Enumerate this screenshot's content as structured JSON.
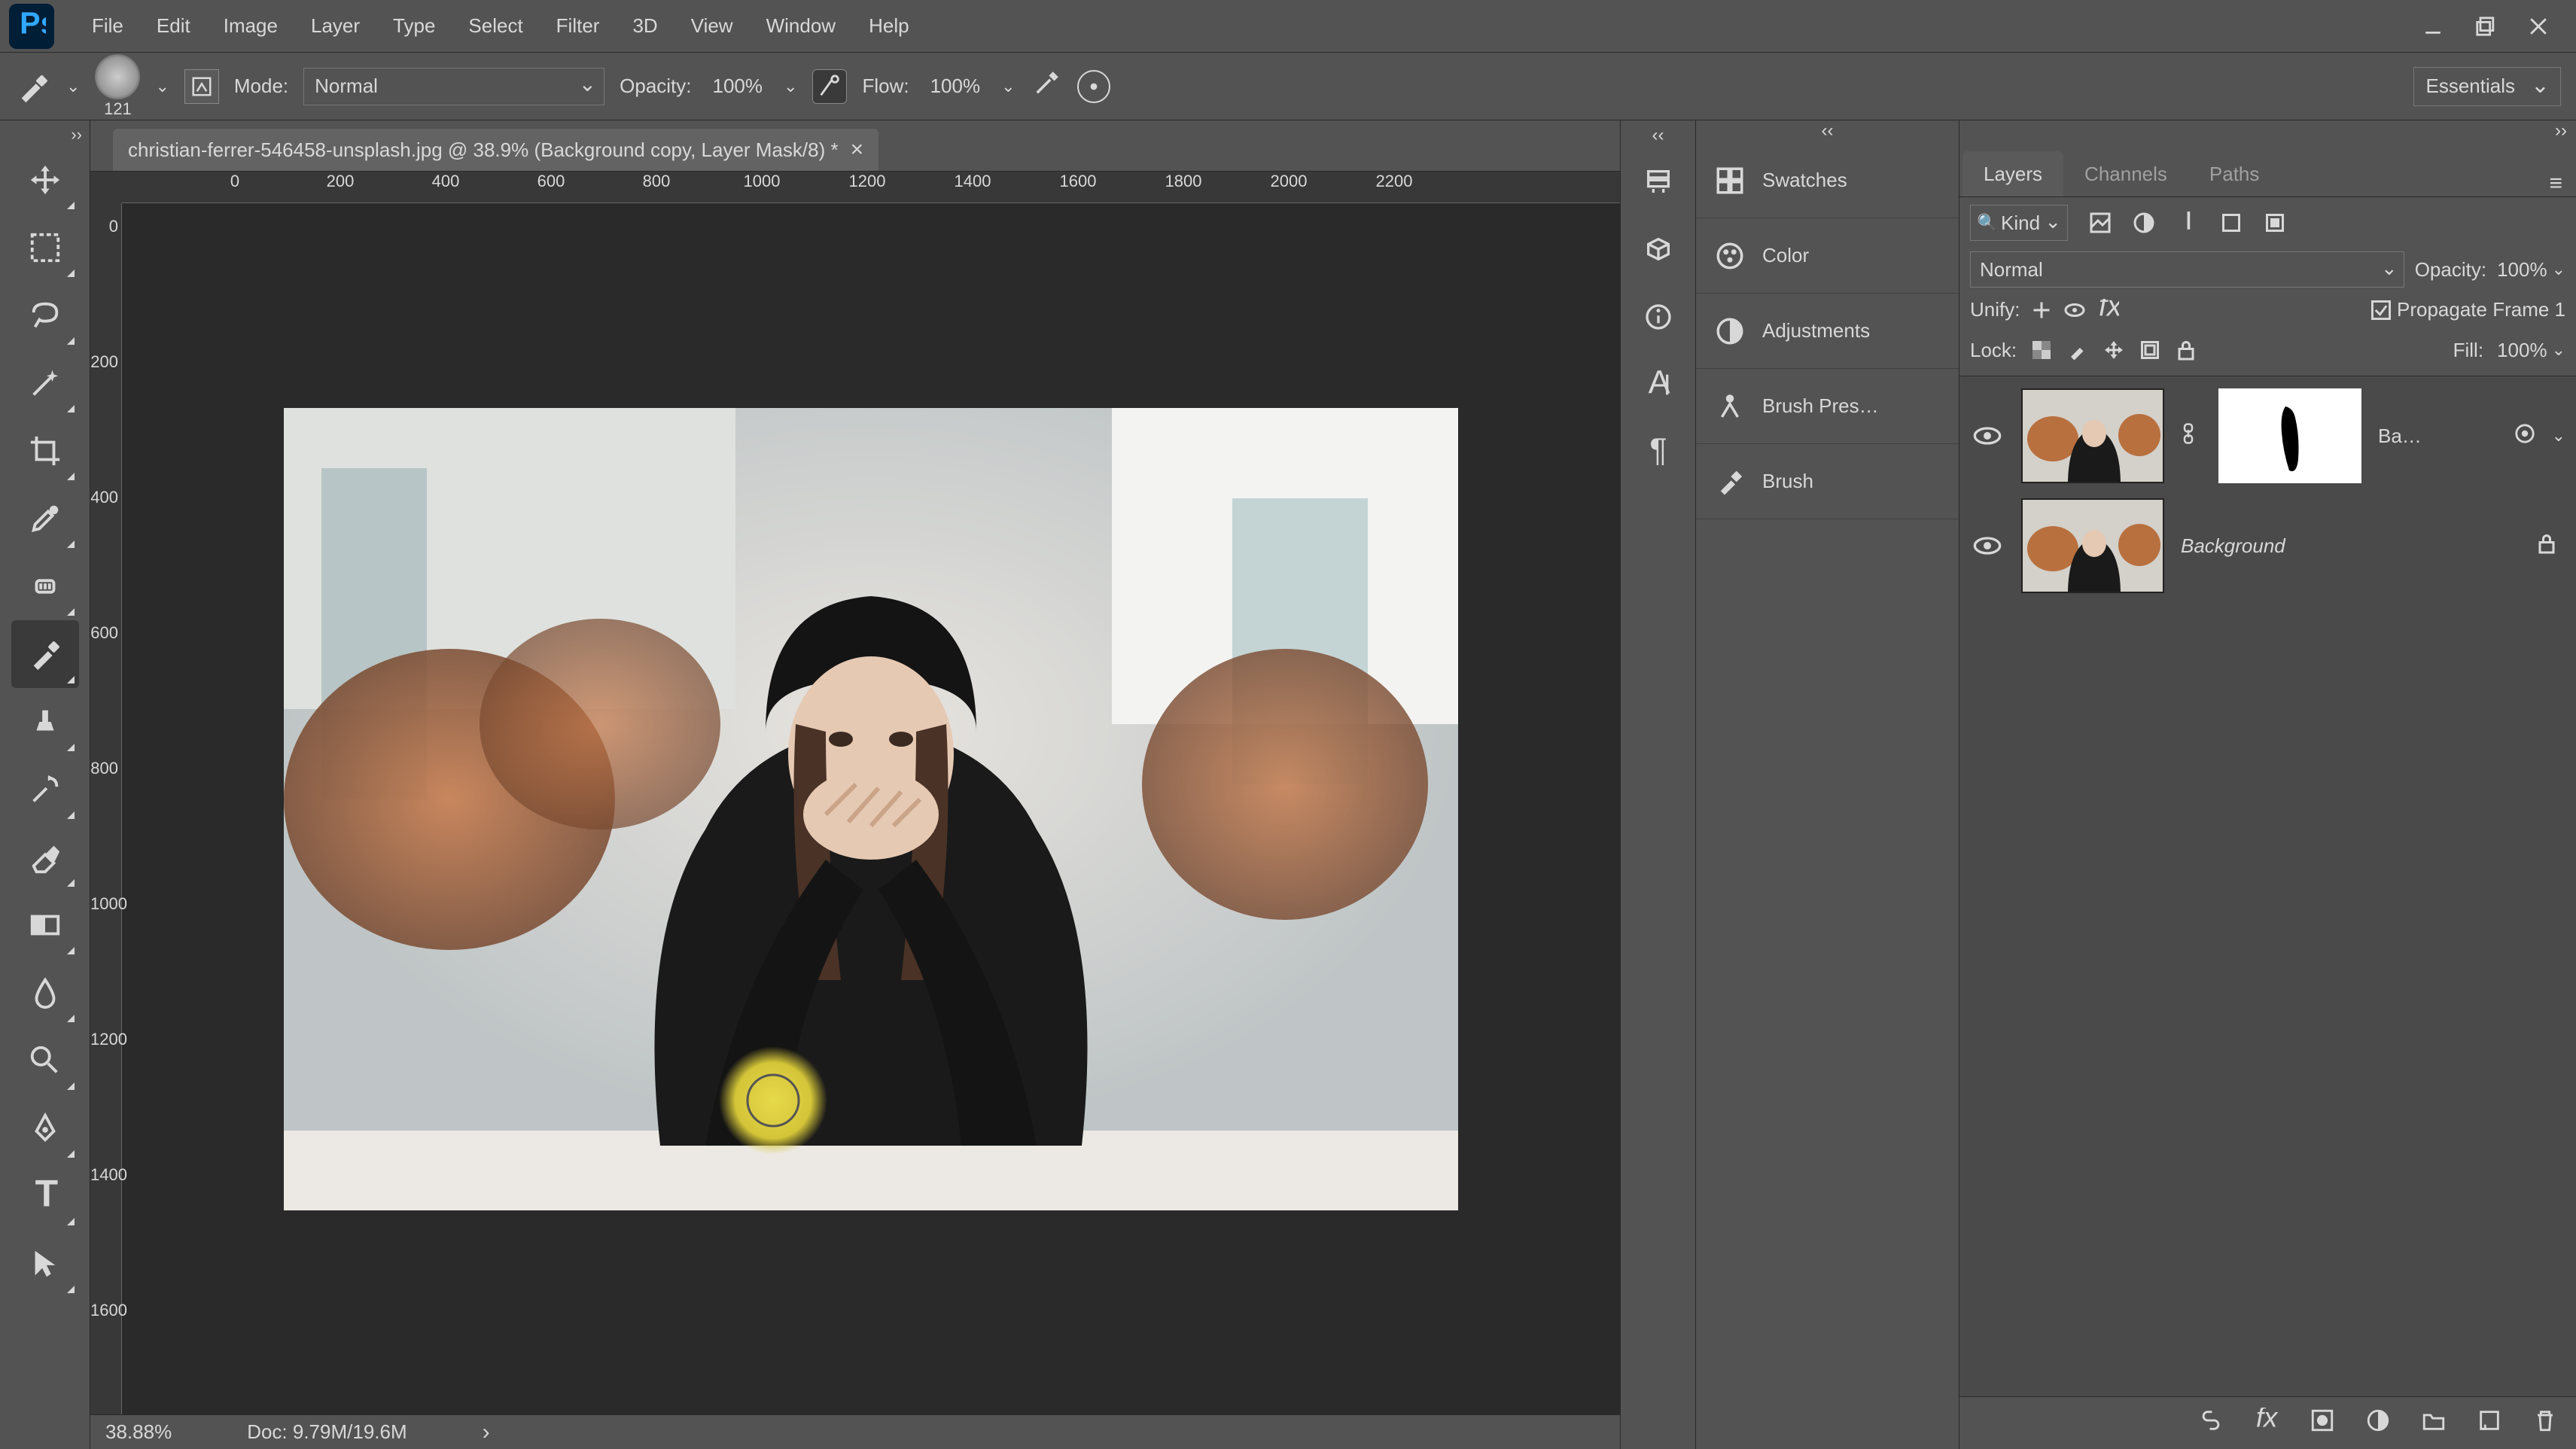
{
  "menu": [
    "File",
    "Edit",
    "Image",
    "Layer",
    "Type",
    "Select",
    "Filter",
    "3D",
    "View",
    "Window",
    "Help"
  ],
  "optbar": {
    "brush_size": "121",
    "mode_label": "Mode:",
    "mode_value": "Normal",
    "opacity_label": "Opacity:",
    "opacity_value": "100%",
    "flow_label": "Flow:",
    "flow_value": "100%",
    "workspace": "Essentials"
  },
  "doc": {
    "tab_title": "christian-ferrer-546458-unsplash.jpg @ 38.9% (Background copy, Layer Mask/8) *",
    "ruler_top": [
      "0",
      "200",
      "400",
      "600",
      "800",
      "1000",
      "1200",
      "1400",
      "1600",
      "1800",
      "2000",
      "2200"
    ],
    "ruler_left": [
      "0",
      "200",
      "400",
      "600",
      "800",
      "1000",
      "1200",
      "1400",
      "1600"
    ],
    "zoom": "38.88%",
    "doc_info": "Doc: 9.79M/19.6M"
  },
  "midpanels": [
    "Swatches",
    "Color",
    "Adjustments",
    "Brush Pres…",
    "Brush"
  ],
  "rightcol": {
    "tabs": [
      "Layers",
      "Channels",
      "Paths"
    ],
    "filter_kind": "Kind",
    "blend_mode": "Normal",
    "opacity_label": "Opacity:",
    "opacity_value": "100%",
    "unify_label": "Unify:",
    "propagate_label": "Propagate Frame 1",
    "lock_label": "Lock:",
    "fill_label": "Fill:",
    "fill_value": "100%",
    "layers": [
      {
        "name": "Ba…",
        "locked": false,
        "mask": true,
        "bg": false
      },
      {
        "name": "Background",
        "locked": true,
        "mask": false,
        "bg": true
      }
    ]
  }
}
